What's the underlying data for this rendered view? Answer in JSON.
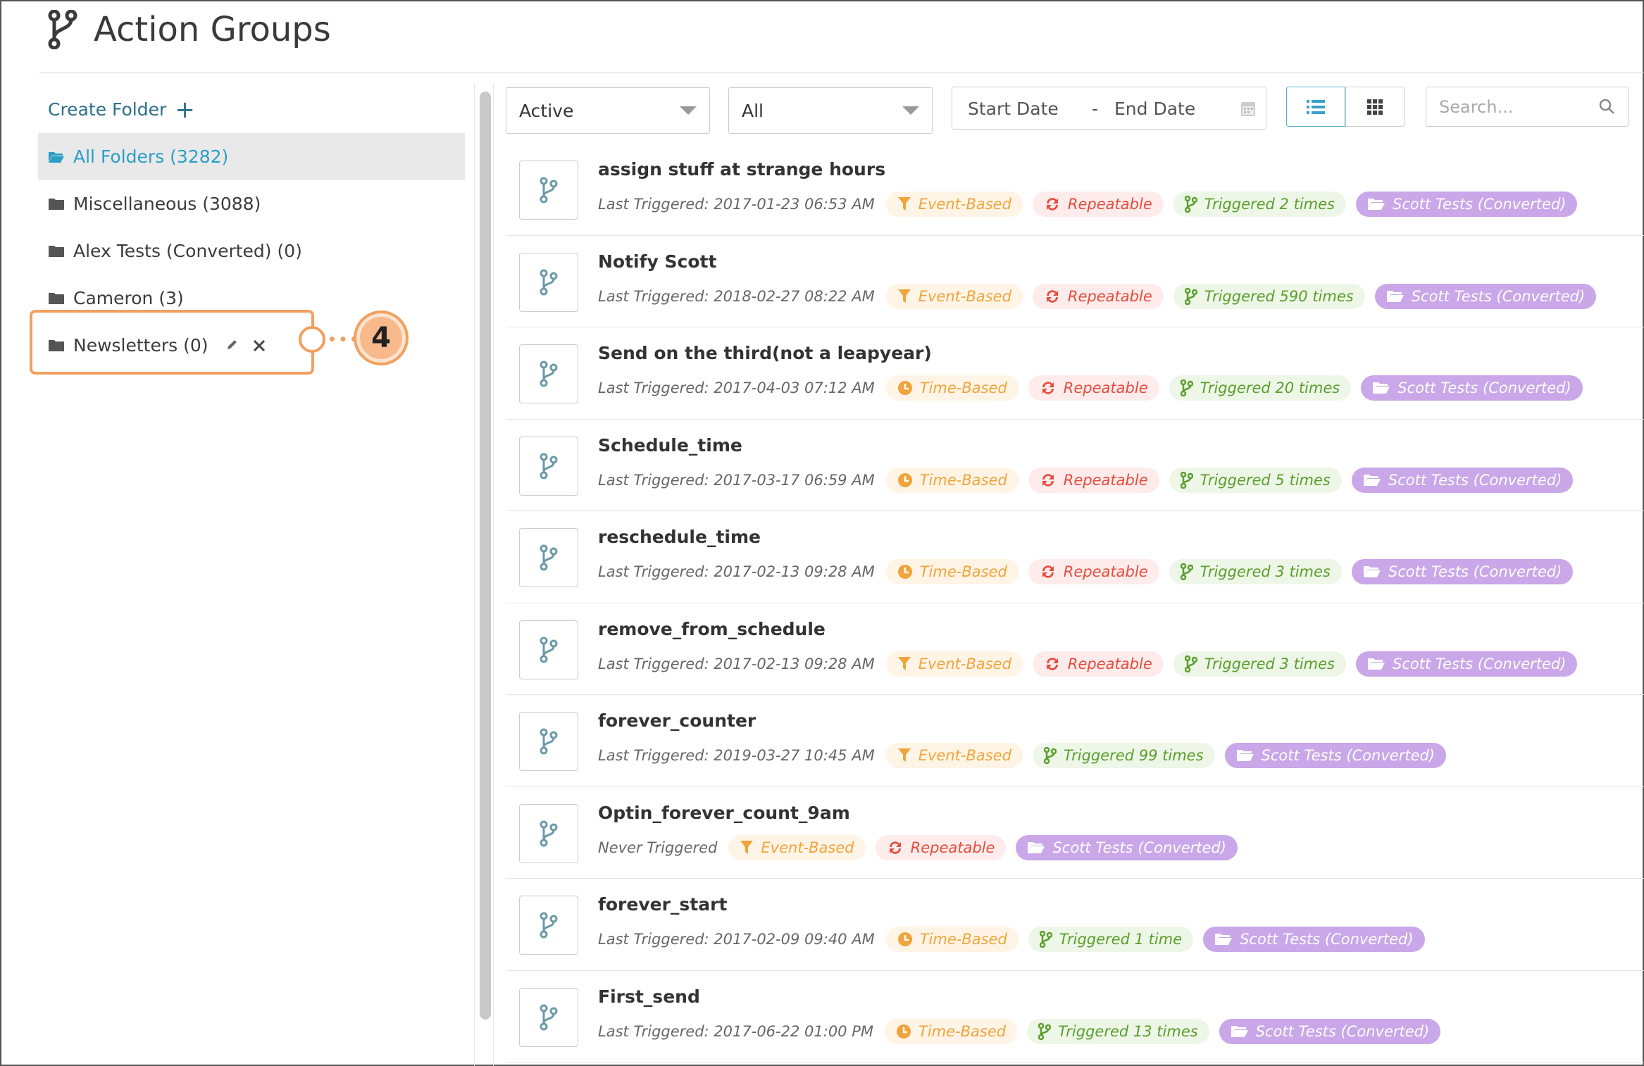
{
  "header": {
    "title": "Action Groups",
    "icon": "branch-icon"
  },
  "sidebar": {
    "create_folder_label": "Create Folder",
    "folders": [
      {
        "label": "All Folders (3282)",
        "active": true
      },
      {
        "label": "Miscellaneous (3088)",
        "active": false
      },
      {
        "label": "Alex Tests (Converted) (0)",
        "active": false
      },
      {
        "label": "Cameron (3)",
        "active": false
      },
      {
        "label": "Newsletters (0)",
        "active": false
      }
    ],
    "callout_number": "4"
  },
  "toolbar": {
    "status_select": "Active",
    "type_select": "All",
    "start_date_placeholder": "Start Date",
    "date_separator": "-",
    "end_date_placeholder": "End Date",
    "search_placeholder": "Search..."
  },
  "colors": {
    "accent": "#2a9fc6",
    "event": "#f0a43c",
    "repeat": "#e74c3c",
    "triggered": "#5a9f2c",
    "folder_badge": "#c9a7e8",
    "callout": "#f2a05f"
  },
  "action_groups": [
    {
      "name": "assign stuff at strange hours",
      "last": "Last Triggered: 2017-01-23 06:53 AM",
      "type": "Event-Based",
      "repeatable": "Repeatable",
      "triggered": "Triggered 2 times",
      "folder": "Scott Tests (Converted)"
    },
    {
      "name": "Notify Scott",
      "last": "Last Triggered: 2018-02-27 08:22 AM",
      "type": "Event-Based",
      "repeatable": "Repeatable",
      "triggered": "Triggered 590 times",
      "folder": "Scott Tests (Converted)"
    },
    {
      "name": "Send on the third(not a leapyear)",
      "last": "Last Triggered: 2017-04-03 07:12 AM",
      "type": "Time-Based",
      "repeatable": "Repeatable",
      "triggered": "Triggered 20 times",
      "folder": "Scott Tests (Converted)"
    },
    {
      "name": "Schedule_time",
      "last": "Last Triggered: 2017-03-17 06:59 AM",
      "type": "Time-Based",
      "repeatable": "Repeatable",
      "triggered": "Triggered 5 times",
      "folder": "Scott Tests (Converted)"
    },
    {
      "name": "reschedule_time",
      "last": "Last Triggered: 2017-02-13 09:28 AM",
      "type": "Time-Based",
      "repeatable": "Repeatable",
      "triggered": "Triggered 3 times",
      "folder": "Scott Tests (Converted)"
    },
    {
      "name": "remove_from_schedule",
      "last": "Last Triggered: 2017-02-13 09:28 AM",
      "type": "Event-Based",
      "repeatable": "Repeatable",
      "triggered": "Triggered 3 times",
      "folder": "Scott Tests (Converted)"
    },
    {
      "name": "forever_counter",
      "last": "Last Triggered: 2019-03-27 10:45 AM",
      "type": "Event-Based",
      "repeatable": null,
      "triggered": "Triggered 99 times",
      "folder": "Scott Tests (Converted)"
    },
    {
      "name": "Optin_forever_count_9am",
      "last": "Never Triggered",
      "type": "Event-Based",
      "repeatable": "Repeatable",
      "triggered": null,
      "folder": "Scott Tests (Converted)"
    },
    {
      "name": "forever_start",
      "last": "Last Triggered: 2017-02-09 09:40 AM",
      "type": "Time-Based",
      "repeatable": null,
      "triggered": "Triggered 1 time",
      "folder": "Scott Tests (Converted)"
    },
    {
      "name": "First_send",
      "last": "Last Triggered: 2017-06-22 01:00 PM",
      "type": "Time-Based",
      "repeatable": null,
      "triggered": "Triggered 13 times",
      "folder": "Scott Tests (Converted)"
    }
  ]
}
